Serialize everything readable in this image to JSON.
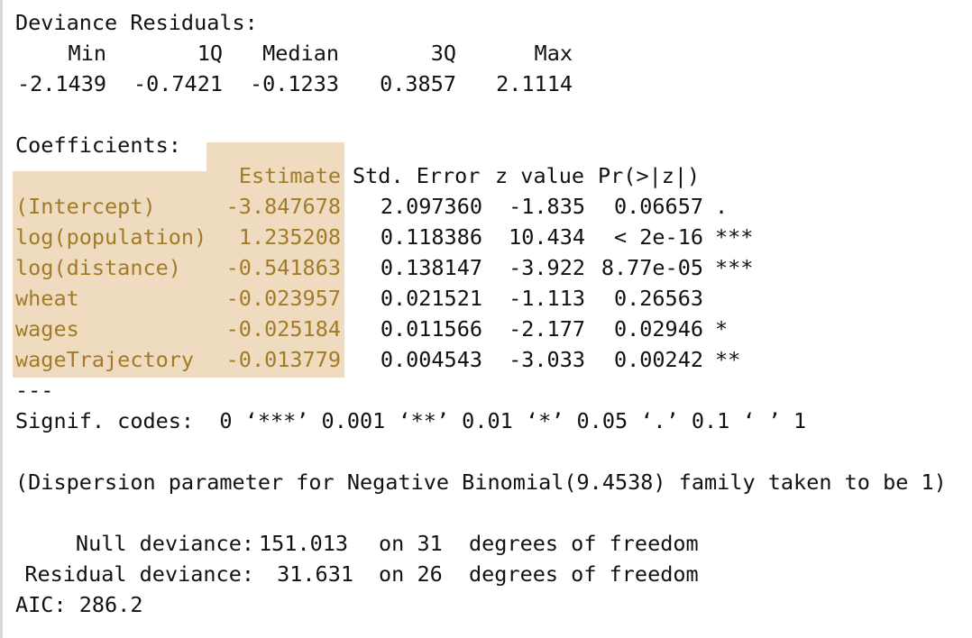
{
  "deviance_residuals": {
    "title": "Deviance Residuals:",
    "headers": [
      "Min",
      "1Q",
      "Median",
      "3Q",
      "Max"
    ],
    "values": [
      "-2.1439",
      "-0.7421",
      "-0.1233",
      "0.3857",
      "2.1114"
    ]
  },
  "coefficients": {
    "title": "Coefficients:",
    "headers": {
      "estimate": "Estimate",
      "std_error": "Std. Error",
      "z_value": "z value",
      "p_value": "Pr(>|z|)"
    },
    "rows": [
      {
        "name": "(Intercept)",
        "estimate": "-3.847678",
        "std_error": "2.097360",
        "z_value": "-1.835",
        "p_value": "0.06657",
        "signif": "."
      },
      {
        "name": "log(population)",
        "estimate": "1.235208",
        "std_error": "0.118386",
        "z_value": "10.434",
        "p_value": "< 2e-16",
        "signif": "***"
      },
      {
        "name": "log(distance)",
        "estimate": "-0.541863",
        "std_error": "0.138147",
        "z_value": "-3.922",
        "p_value": "8.77e-05",
        "signif": "***"
      },
      {
        "name": "wheat",
        "estimate": "-0.023957",
        "std_error": "0.021521",
        "z_value": "-1.113",
        "p_value": "0.26563",
        "signif": ""
      },
      {
        "name": "wages",
        "estimate": "-0.025184",
        "std_error": "0.011566",
        "z_value": "-2.177",
        "p_value": "0.02946",
        "signif": "*"
      },
      {
        "name": "wageTrajectory",
        "estimate": "-0.013779",
        "std_error": "0.004543",
        "z_value": "-3.033",
        "p_value": "0.00242",
        "signif": "**"
      }
    ]
  },
  "separator": "---",
  "signif_codes": "Signif. codes:  0 ‘***’ 0.001 ‘**’ 0.01 ‘*’ 0.05 ‘.’ 0.1 ‘ ’ 1",
  "dispersion_note": "(Dispersion parameter for Negative Binomial(9.4538) family taken to be 1)",
  "null_deviance": {
    "label": "Null deviance:",
    "value": "151.013",
    "df_text": "on 31",
    "suffix": "degrees of freedom"
  },
  "residual_deviance": {
    "label": "Residual deviance:",
    "value": "31.631",
    "df_text": "on 26",
    "suffix": "degrees of freedom"
  },
  "aic": "AIC: 286.2",
  "colors": {
    "highlight_background": "#efdbc0",
    "highlight_text": "#a17b26",
    "text": "#111111"
  }
}
